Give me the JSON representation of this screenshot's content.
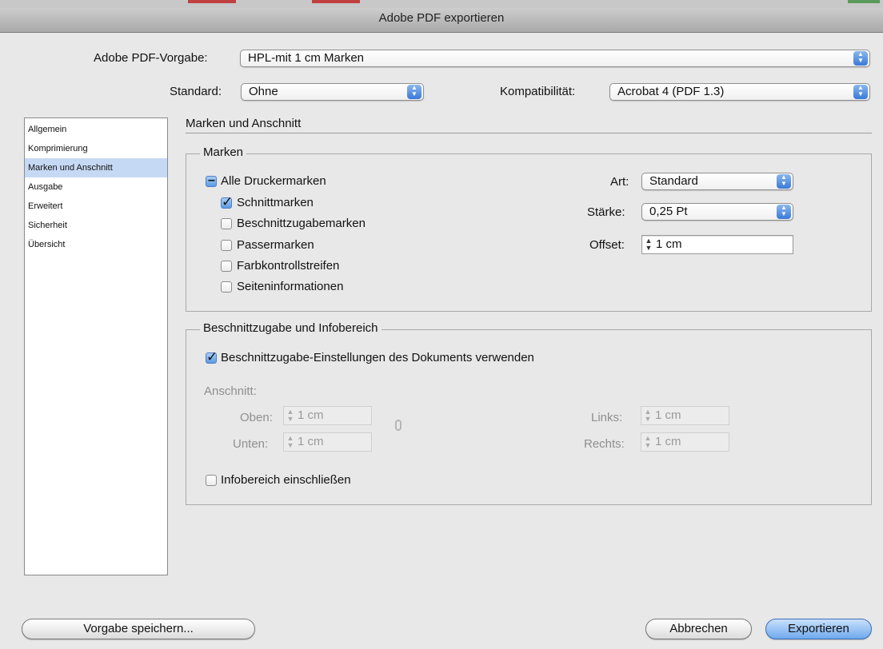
{
  "window": {
    "title": "Adobe PDF exportieren"
  },
  "preset": {
    "label": "Adobe PDF-Vorgabe:",
    "value": "HPL-mit 1 cm Marken"
  },
  "standard": {
    "label": "Standard:",
    "value": "Ohne"
  },
  "compat": {
    "label": "Kompatibilität:",
    "value": "Acrobat 4 (PDF 1.3)"
  },
  "sidebar": {
    "items": [
      {
        "label": "Allgemein"
      },
      {
        "label": "Komprimierung"
      },
      {
        "label": "Marken und Anschnitt"
      },
      {
        "label": "Ausgabe"
      },
      {
        "label": "Erweitert"
      },
      {
        "label": "Sicherheit"
      },
      {
        "label": "Übersicht"
      }
    ],
    "selected_index": 2
  },
  "panel": {
    "title": "Marken und Anschnitt"
  },
  "marks": {
    "legend": "Marken",
    "all": {
      "label": "Alle Druckermarken",
      "state": "mixed"
    },
    "items": [
      {
        "label": "Schnittmarken",
        "checked": true
      },
      {
        "label": "Beschnittzugabemarken",
        "checked": false
      },
      {
        "label": "Passermarken",
        "checked": false
      },
      {
        "label": "Farbkontrollstreifen",
        "checked": false
      },
      {
        "label": "Seiteninformationen",
        "checked": false
      }
    ],
    "art": {
      "label": "Art:",
      "value": "Standard"
    },
    "staerke": {
      "label": "Stärke:",
      "value": "0,25 Pt"
    },
    "offset": {
      "label": "Offset:",
      "value": "1 cm"
    }
  },
  "bleed": {
    "legend": "Beschnittzugabe und Infobereich",
    "use_doc": {
      "label": "Beschnittzugabe-Einstellungen des Dokuments verwenden",
      "checked": true
    },
    "anschnitt_label": "Anschnitt:",
    "oben": {
      "label": "Oben:",
      "value": "1 cm"
    },
    "unten": {
      "label": "Unten:",
      "value": "1 cm"
    },
    "links": {
      "label": "Links:",
      "value": "1 cm"
    },
    "rechts": {
      "label": "Rechts:",
      "value": "1 cm"
    },
    "infobereich": {
      "label": "Infobereich einschließen",
      "checked": false
    }
  },
  "buttons": {
    "save_preset": "Vorgabe speichern...",
    "cancel": "Abbrechen",
    "export": "Exportieren"
  },
  "colors": {
    "selection": "#c6d9f4",
    "accent": "#3a78d8"
  }
}
